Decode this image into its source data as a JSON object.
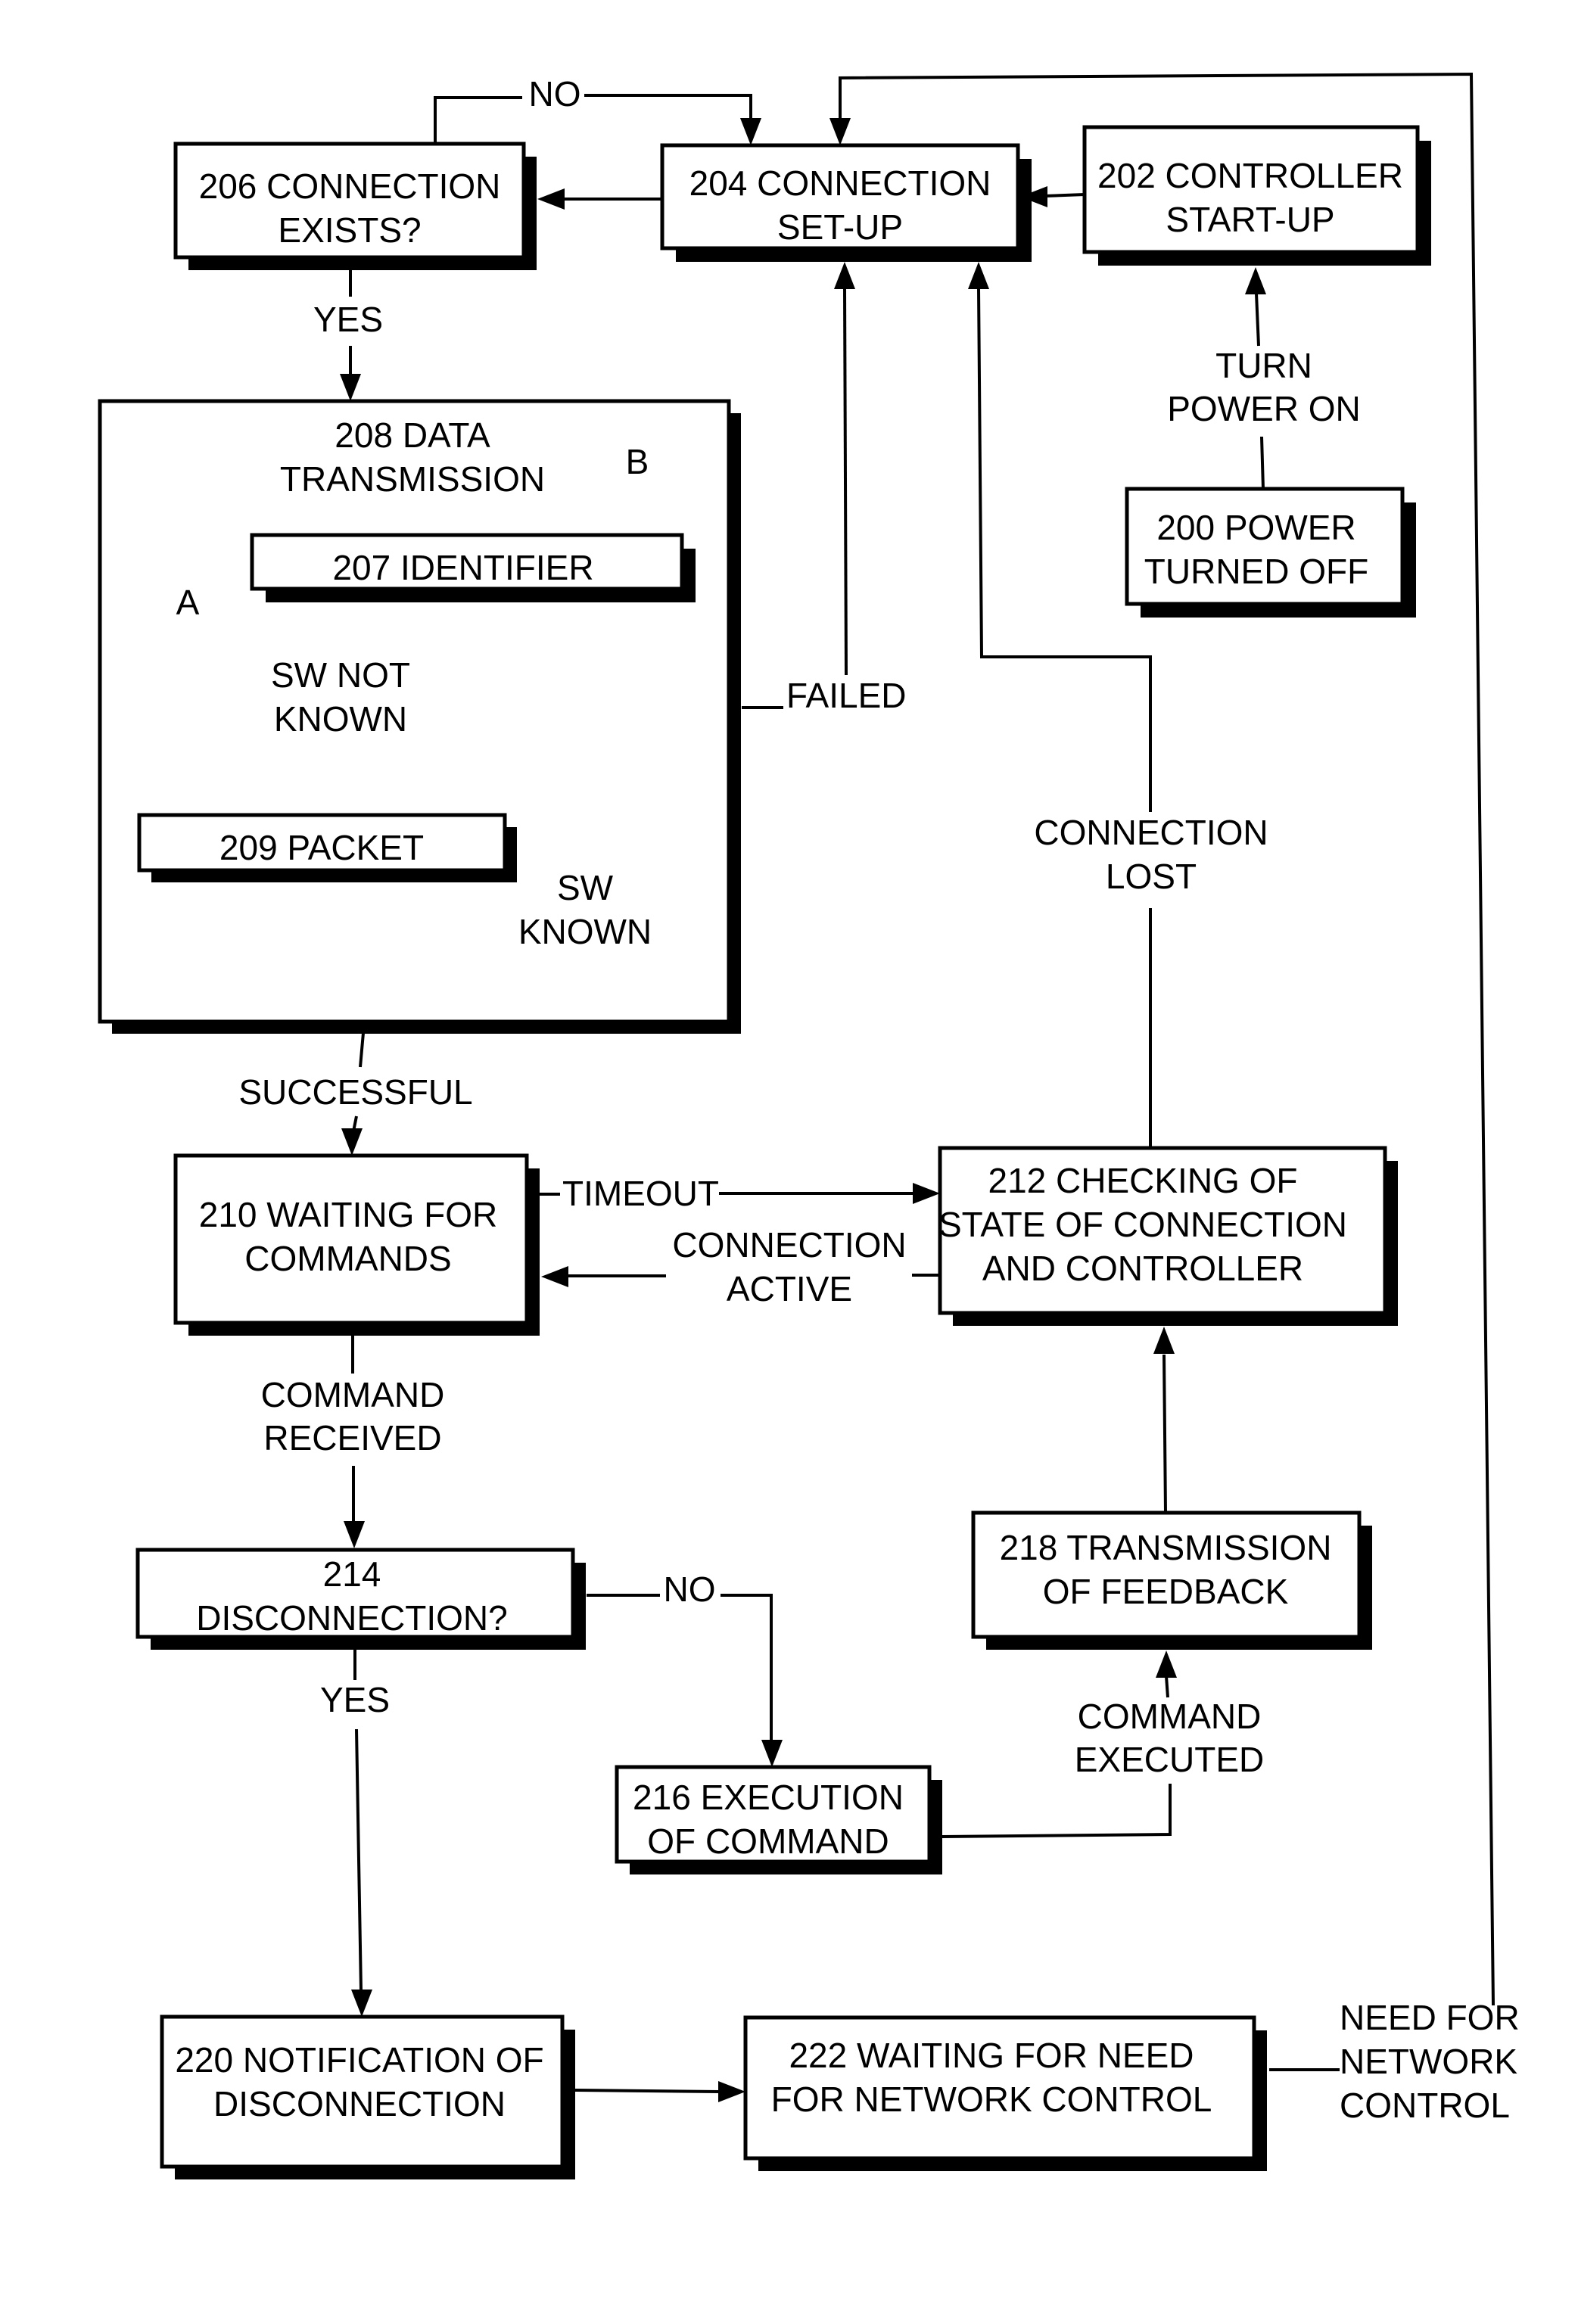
{
  "diagram": {
    "type": "flowchart",
    "colors": {
      "ink": "#000000",
      "paper": "#ffffff"
    },
    "nodes": {
      "n200": {
        "lines": [
          "200 POWER",
          "TURNED OFF"
        ]
      },
      "n202": {
        "lines": [
          "202 CONTROLLER",
          "START-UP"
        ]
      },
      "n204": {
        "lines": [
          "204 CONNECTION",
          "SET-UP"
        ]
      },
      "n206": {
        "lines": [
          "206 CONNECTION",
          "EXISTS?"
        ]
      },
      "n207": {
        "lines": [
          "207 IDENTIFIER"
        ]
      },
      "n208": {
        "lines": [
          "208 DATA",
          "TRANSMISSION"
        ]
      },
      "n209": {
        "lines": [
          "209 PACKET"
        ]
      },
      "n210": {
        "lines": [
          "210 WAITING FOR",
          "COMMANDS"
        ]
      },
      "n212": {
        "lines": [
          "212 CHECKING OF",
          "STATE OF CONNECTION",
          "AND CONTROLLER"
        ]
      },
      "n214": {
        "lines": [
          "214",
          "DISCONNECTION?"
        ]
      },
      "n216": {
        "lines": [
          "216 EXECUTION",
          "OF COMMAND"
        ]
      },
      "n218": {
        "lines": [
          "218 TRANSMISSION",
          "OF FEEDBACK"
        ]
      },
      "n220": {
        "lines": [
          "220 NOTIFICATION OF",
          "DISCONNECTION"
        ]
      },
      "n222": {
        "lines": [
          "222 WAITING FOR NEED",
          "FOR NETWORK CONTROL"
        ]
      }
    },
    "edge_labels": {
      "no_206": [
        "NO"
      ],
      "yes_206": [
        "YES"
      ],
      "turn_power_on": [
        "TURN",
        "POWER ON"
      ],
      "path_a": [
        "A"
      ],
      "path_b": [
        "B"
      ],
      "sw_not_known": [
        "SW NOT",
        "KNOWN"
      ],
      "sw_known": [
        "SW",
        "KNOWN"
      ],
      "failed": [
        "FAILED"
      ],
      "connection_lost": [
        "CONNECTION",
        "LOST"
      ],
      "successful": [
        "SUCCESSFUL"
      ],
      "timeout": [
        "TIMEOUT"
      ],
      "connection_active": [
        "CONNECTION",
        "ACTIVE"
      ],
      "command_received": [
        "COMMAND",
        "RECEIVED"
      ],
      "no_214": [
        "NO"
      ],
      "yes_214": [
        "YES"
      ],
      "command_executed": [
        "COMMAND",
        "EXECUTED"
      ],
      "need_for_network_control": [
        "NEED FOR",
        "NETWORK",
        "CONTROL"
      ]
    },
    "edges": [
      {
        "from": "n200",
        "to": "n202",
        "label": "turn_power_on"
      },
      {
        "from": "n202",
        "to": "n204"
      },
      {
        "from": "n204",
        "to": "n206"
      },
      {
        "from": "n206",
        "to": "n204",
        "label": "no_206"
      },
      {
        "from": "n206",
        "to": "n208",
        "label": "yes_206"
      },
      {
        "from": "n208",
        "to": "n209",
        "label": "path_a"
      },
      {
        "from": "n208",
        "to": "n207",
        "label": "path_b"
      },
      {
        "from": "n207",
        "to": "n209",
        "label": "sw_not_known"
      },
      {
        "from": "n207",
        "to": "n208",
        "label": "sw_known"
      },
      {
        "from": "n208",
        "to": "n204",
        "label": "failed"
      },
      {
        "from": "n208",
        "to": "n210",
        "label": "successful"
      },
      {
        "from": "n210",
        "to": "n212",
        "label": "timeout"
      },
      {
        "from": "n212",
        "to": "n210",
        "label": "connection_active"
      },
      {
        "from": "n212",
        "to": "n204",
        "label": "connection_lost"
      },
      {
        "from": "n210",
        "to": "n214",
        "label": "command_received"
      },
      {
        "from": "n214",
        "to": "n216",
        "label": "no_214"
      },
      {
        "from": "n214",
        "to": "n220",
        "label": "yes_214"
      },
      {
        "from": "n216",
        "to": "n218",
        "label": "command_executed"
      },
      {
        "from": "n218",
        "to": "n212"
      },
      {
        "from": "n220",
        "to": "n222"
      },
      {
        "from": "n222",
        "to": "n204",
        "label": "need_for_network_control"
      }
    ]
  }
}
